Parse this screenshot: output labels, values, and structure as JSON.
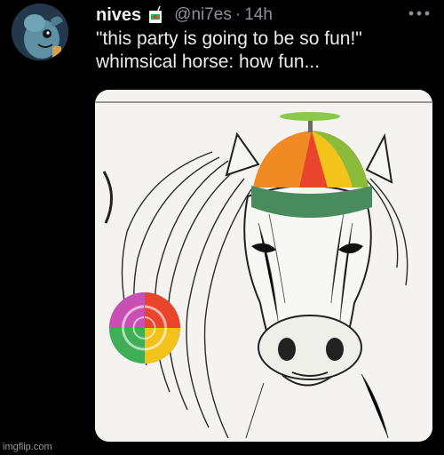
{
  "tweet": {
    "display_name": "nives",
    "handle": "@ni7es",
    "separator": "·",
    "time": "14h",
    "text_line1": "\"this party is going to be so fun!\"",
    "text_line2": "whimsical horse: how fun..."
  },
  "icons": {
    "avatar": "cartoon-creature-avatar",
    "badge": "juice-box-icon",
    "more": "more-horizontal-icon"
  },
  "watermark": "imgflip.com",
  "colors": {
    "background": "#000000",
    "text": "#e7e9ea",
    "secondary": "#8b9198"
  }
}
